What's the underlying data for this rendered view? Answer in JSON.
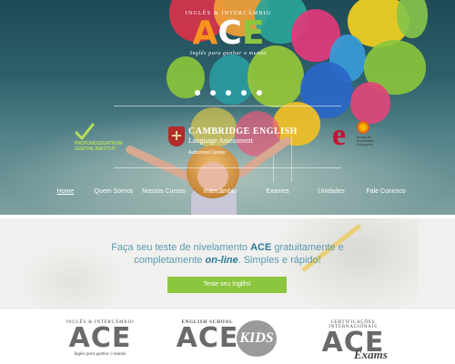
{
  "logo": {
    "top": "INGLÊS & INTERCÂMBIO",
    "letters": [
      {
        "char": "A",
        "color": "#f7941d"
      },
      {
        "char": "C",
        "color": "#ffffff"
      },
      {
        "char": "E",
        "color": "#8cc63f"
      }
    ],
    "tagline": "Inglês para ganhar o mundo"
  },
  "carousel": {
    "dots": 5
  },
  "partners": {
    "goethe": {
      "label": "PRÜFUNGSZENTRUM GOETHE-INSTITUT",
      "icon": "checkmark-icon"
    },
    "cambridge": {
      "line1": "CAMBRIDGE ENGLISH",
      "line2": "Language Assessment",
      "line3": "Authorised Centre",
      "icon": "cambridge-shield-icon"
    },
    "eprov": {
      "letter": "e",
      "text": "Bureau de Examination Portuguese"
    }
  },
  "nav": {
    "items": [
      {
        "label": "Home",
        "active": true
      },
      {
        "label": "Quem Somos",
        "active": false
      },
      {
        "label": "Nossos Cursos",
        "active": false
      },
      {
        "label": "Intercâmbio",
        "active": false
      },
      {
        "label": "Exames",
        "active": false
      },
      {
        "label": "Unidades",
        "active": false
      },
      {
        "label": "Fale Conosco",
        "active": false
      }
    ]
  },
  "promo": {
    "text_part1": "Faça seu teste de nivelamento ",
    "brand": "ACE",
    "text_part2": " gratuitamente e completamente ",
    "online": "on-line",
    "text_part3": ". Simples e rápido!",
    "cta_label": "Teste seu Inglês!"
  },
  "bottom_logos": [
    {
      "top": "INGLÊS & INTERCÂMBIO",
      "word": "ACE",
      "tag": "Inglês para ganhar o mundo"
    },
    {
      "top": "ENGLISH SCHOOL",
      "word": "ACE",
      "tag": "",
      "extra": "KIDS"
    },
    {
      "top": "CERTIFICAÇÕES INTERNACIONAIS",
      "word": "ACE",
      "tag": "",
      "extra": "Exams"
    }
  ],
  "colors": {
    "accent_green": "#8cc63f",
    "accent_orange": "#f7941d",
    "promo_blue": "#5a9ab0"
  }
}
